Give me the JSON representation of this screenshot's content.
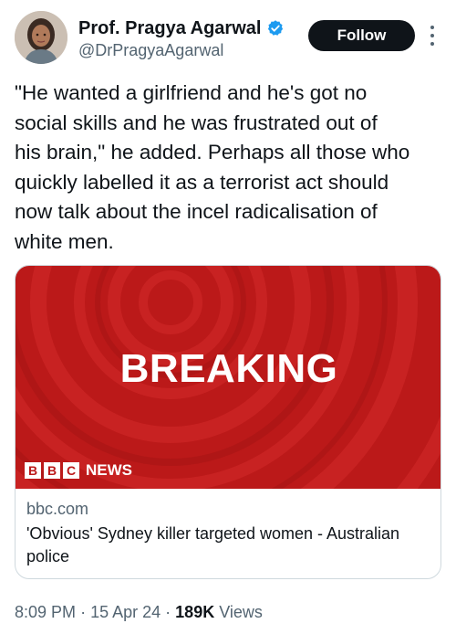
{
  "author": {
    "display_name": "Prof. Pragya Agarwal",
    "handle": "@DrPragyaAgarwal",
    "verified_icon": "verified-badge-icon",
    "avatar": "avatar-photo"
  },
  "follow_label": "Follow",
  "more_icon": "more-options-icon",
  "tweet": {
    "text": "\"He wanted a girlfriend and he's got no\nsocial skills and he was frustrated out of\nhis brain,\" he added. Perhaps all those who\nquickly labelled it as a terrorist act should\nnow talk about the incel radicalisation of\nwhite men."
  },
  "card": {
    "image_headline": "BREAKING",
    "logo_letters": [
      "B",
      "B",
      "C"
    ],
    "logo_news": "NEWS",
    "domain": "bbc.com",
    "title": "'Obvious' Sydney killer targeted women - Australian police"
  },
  "meta": {
    "time": "8:09 PM",
    "separator": "·",
    "date": "15 Apr 24",
    "views_count": "189K",
    "views_label": "Views"
  },
  "colors": {
    "verified_blue": "#1d9bf0",
    "bbc_red": "#bb1919",
    "follow_bg": "#0f1419",
    "secondary_text": "#536471"
  }
}
